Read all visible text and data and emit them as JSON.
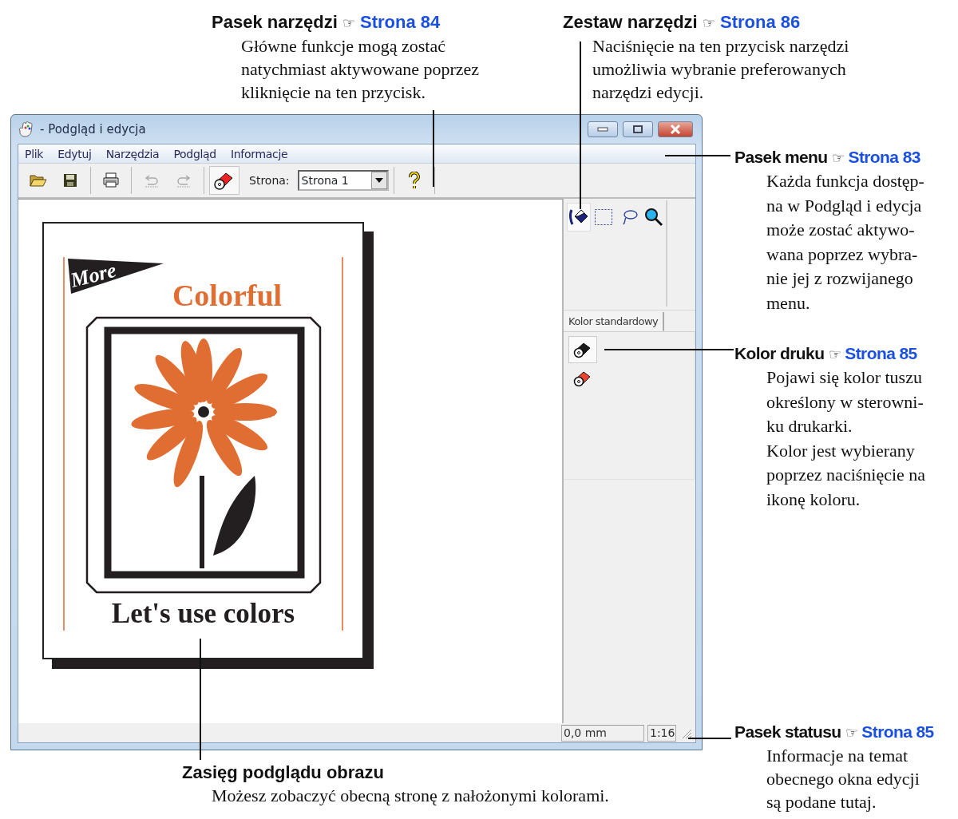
{
  "callouts_top": [
    {
      "title": "Pasek narzędzi",
      "ref_symbol": "☞",
      "ref": "Strona 84",
      "lines": [
        "Główne funkcje mogą zostać",
        "natychmiast aktywowane poprzez",
        "kliknięcie na ten przycisk."
      ]
    },
    {
      "title": "Zestaw narzędzi",
      "ref_symbol": "☞",
      "ref": "Strona 86",
      "lines": [
        "Naciśnięcie na ten przycisk narzędzi",
        "umożliwia wybranie preferowanych",
        "narzędzi edycji."
      ]
    }
  ],
  "window": {
    "title": "- Podgląd i edycja",
    "menu": [
      "Plik",
      "Edytuj",
      "Narzędzia",
      "Podgląd",
      "Informacje"
    ],
    "toolbar": [
      {
        "disabled": false,
        "on": false
      },
      {
        "disabled": false,
        "on": false
      },
      {
        "disabled": false,
        "on": false
      },
      {
        "disabled": true,
        "on": false
      },
      {
        "disabled": true,
        "on": false
      },
      {
        "disabled": false,
        "on": true
      }
    ],
    "page_field": {
      "label": "Strona:",
      "value": "Strona 1"
    },
    "help_button": {
      "disabled": false
    },
    "preview": {
      "badge": "More",
      "headline": "Colorful",
      "caption": "Let's use colors"
    },
    "tools": [
      {
        "selected": true
      },
      {
        "selected": false
      },
      {
        "selected": false
      },
      {
        "selected": false
      }
    ],
    "tabs": [
      {
        "label": "Kolor standardowy",
        "selected": true
      }
    ],
    "colors": [
      {
        "color": "#1a1a1a",
        "selected": true
      },
      {
        "color": "#e8432e",
        "selected": false
      }
    ],
    "status_bar": {
      "position": "0,0 mm",
      "scale": "1:16"
    }
  },
  "callouts_right": [
    {
      "title": "Pasek menu",
      "ref_symbol": "☞",
      "ref": "Strona 83",
      "lines": [
        "Każda funkcja dostęp-",
        "na w Podgląd i edycja",
        "może zostać aktywo-",
        "wana poprzez wybra-",
        "nie jej z rozwijanego",
        "menu."
      ]
    },
    {
      "title": "Kolor druku",
      "ref_symbol": "☞",
      "ref": "Strona 85",
      "lines": [
        "Pojawi się kolor tuszu",
        "określony w sterowni-",
        "ku drukarki.",
        "Kolor jest wybierany",
        "poprzez naciśnięcie na",
        "ikonę koloru."
      ]
    },
    {
      "title": "Pasek statusu",
      "ref_symbol": "☞",
      "ref": "Strona 85",
      "lines": [
        "Informacje na temat",
        "obecnego okna edycji",
        "są podane tutaj."
      ]
    }
  ],
  "callout_bottom": {
    "title": "Zasięg podglądu obrazu",
    "lines": [
      "Możesz zobaczyć obecną stronę z nałożonymi kolorami."
    ]
  }
}
